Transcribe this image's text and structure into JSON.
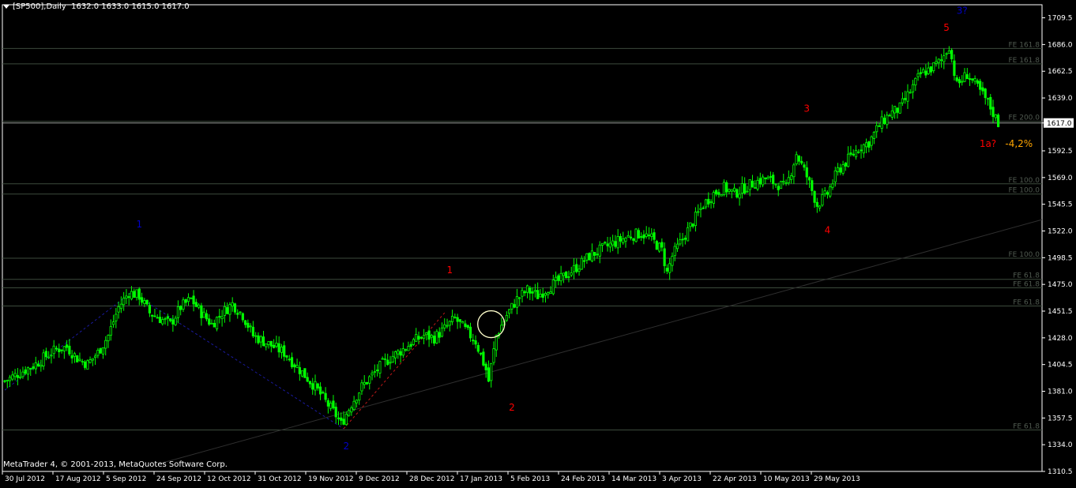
{
  "header": {
    "symbol": "[SP500],Daily",
    "ohlc": "1632.0 1633.0 1615.0 1617.0"
  },
  "footer": {
    "copyright": "MetaTrader 4, © 2001-2013, MetaQuotes Software Corp."
  },
  "colors": {
    "background": "#000000",
    "candle": "#00ff00",
    "grid": "#3c4a3c",
    "axis": "#ffffff",
    "label_red": "#ff0000",
    "label_blue": "#0000c8",
    "label_orange": "#ffa500",
    "fib_text": "#505a50"
  },
  "chart_data": {
    "type": "candlestick",
    "ylim": [
      1310.5,
      1721
    ],
    "y_ticks": [
      1709.5,
      1686.0,
      1662.5,
      1639.0,
      1617.0,
      1592.5,
      1569.0,
      1545.5,
      1522.0,
      1498.5,
      1475.0,
      1451.5,
      1428.0,
      1404.5,
      1381.0,
      1357.5,
      1334.0,
      1310.5
    ],
    "current_price": "1617.0",
    "x_ticks": [
      "30 Jul 2012",
      "17 Aug 2012",
      "5 Sep 2012",
      "24 Sep 2012",
      "12 Oct 2012",
      "31 Oct 2012",
      "19 Nov 2012",
      "9 Dec 2012",
      "28 Dec 2012",
      "17 Jan 2013",
      "5 Feb 2013",
      "24 Feb 2013",
      "14 Mar 2013",
      "3 Apr 2013",
      "22 Apr 2013",
      "10 May 2013",
      "29 May 2013"
    ],
    "close_path": [
      [
        0,
        1390
      ],
      [
        4,
        1395
      ],
      [
        8,
        1400
      ],
      [
        12,
        1405
      ],
      [
        16,
        1412
      ],
      [
        20,
        1418
      ],
      [
        24,
        1420
      ],
      [
        28,
        1410
      ],
      [
        32,
        1405
      ],
      [
        36,
        1415
      ],
      [
        40,
        1430
      ],
      [
        44,
        1455
      ],
      [
        48,
        1468
      ],
      [
        52,
        1465
      ],
      [
        56,
        1450
      ],
      [
        60,
        1445
      ],
      [
        64,
        1440
      ],
      [
        68,
        1455
      ],
      [
        72,
        1462
      ],
      [
        76,
        1450
      ],
      [
        80,
        1440
      ],
      [
        84,
        1450
      ],
      [
        88,
        1458
      ],
      [
        92,
        1448
      ],
      [
        96,
        1430
      ],
      [
        100,
        1425
      ],
      [
        104,
        1420
      ],
      [
        108,
        1415
      ],
      [
        112,
        1405
      ],
      [
        116,
        1395
      ],
      [
        120,
        1385
      ],
      [
        124,
        1372
      ],
      [
        128,
        1360
      ],
      [
        130,
        1352
      ],
      [
        134,
        1370
      ],
      [
        138,
        1385
      ],
      [
        142,
        1395
      ],
      [
        146,
        1405
      ],
      [
        150,
        1412
      ],
      [
        154,
        1418
      ],
      [
        158,
        1425
      ],
      [
        162,
        1430
      ],
      [
        166,
        1428
      ],
      [
        170,
        1436
      ],
      [
        174,
        1445
      ],
      [
        178,
        1435
      ],
      [
        182,
        1425
      ],
      [
        186,
        1400
      ],
      [
        187,
        1390
      ],
      [
        190,
        1430
      ],
      [
        194,
        1448
      ],
      [
        198,
        1462
      ],
      [
        202,
        1470
      ],
      [
        206,
        1465
      ],
      [
        210,
        1472
      ],
      [
        214,
        1478
      ],
      [
        218,
        1485
      ],
      [
        222,
        1492
      ],
      [
        226,
        1500
      ],
      [
        230,
        1505
      ],
      [
        234,
        1510
      ],
      [
        238,
        1514
      ],
      [
        242,
        1518
      ],
      [
        246,
        1520
      ],
      [
        250,
        1515
      ],
      [
        254,
        1505
      ],
      [
        256,
        1485
      ],
      [
        258,
        1500
      ],
      [
        262,
        1515
      ],
      [
        266,
        1530
      ],
      [
        270,
        1545
      ],
      [
        274,
        1555
      ],
      [
        278,
        1560
      ],
      [
        282,
        1555
      ],
      [
        286,
        1560
      ],
      [
        290,
        1565
      ],
      [
        294,
        1568
      ],
      [
        298,
        1564
      ],
      [
        302,
        1560
      ],
      [
        306,
        1590
      ],
      [
        310,
        1570
      ],
      [
        314,
        1545
      ],
      [
        318,
        1555
      ],
      [
        322,
        1575
      ],
      [
        326,
        1585
      ],
      [
        330,
        1595
      ],
      [
        334,
        1600
      ],
      [
        338,
        1615
      ],
      [
        342,
        1625
      ],
      [
        346,
        1630
      ],
      [
        350,
        1645
      ],
      [
        354,
        1660
      ],
      [
        358,
        1665
      ],
      [
        362,
        1672
      ],
      [
        365,
        1685
      ],
      [
        368,
        1650
      ],
      [
        372,
        1660
      ],
      [
        376,
        1648
      ],
      [
        380,
        1635
      ],
      [
        384,
        1617
      ]
    ],
    "fib_levels": [
      {
        "label": "FE 161.8",
        "value": 1682.5
      },
      {
        "label": "FE 161.8",
        "value": 1669.0
      },
      {
        "label": "FE 200.0",
        "value": 1618.5
      },
      {
        "label": "FE 100.0",
        "value": 1563.5
      },
      {
        "label": "FE 100.0",
        "value": 1554.5
      },
      {
        "label": "FE 100.0",
        "value": 1498.0
      },
      {
        "label": "FE 61.8",
        "value": 1479.5
      },
      {
        "label": "FE 61.8",
        "value": 1472.0
      },
      {
        "label": "FE 61.8",
        "value": 1456.0
      },
      {
        "label": "FE 61.8",
        "value": 1347.0
      }
    ],
    "wave_labels": [
      {
        "text": "1",
        "color": "blue",
        "t": 52,
        "p": 1525
      },
      {
        "text": "2",
        "color": "blue",
        "t": 132,
        "p": 1330
      },
      {
        "text": "1",
        "color": "red",
        "t": 172,
        "p": 1485
      },
      {
        "text": "2",
        "color": "red",
        "t": 196,
        "p": 1364
      },
      {
        "text": "3",
        "color": "red",
        "t": 310,
        "p": 1627
      },
      {
        "text": "4",
        "color": "red",
        "t": 318,
        "p": 1520
      },
      {
        "text": "5",
        "color": "red",
        "t": 364,
        "p": 1698
      },
      {
        "text": "3?",
        "color": "blue",
        "t": 370,
        "p": 1713
      },
      {
        "text": "1a?",
        "color": "red",
        "t": 380,
        "p": 1596
      },
      {
        "text": "-4,2%",
        "color": "orange",
        "t": 392,
        "p": 1596
      }
    ]
  }
}
